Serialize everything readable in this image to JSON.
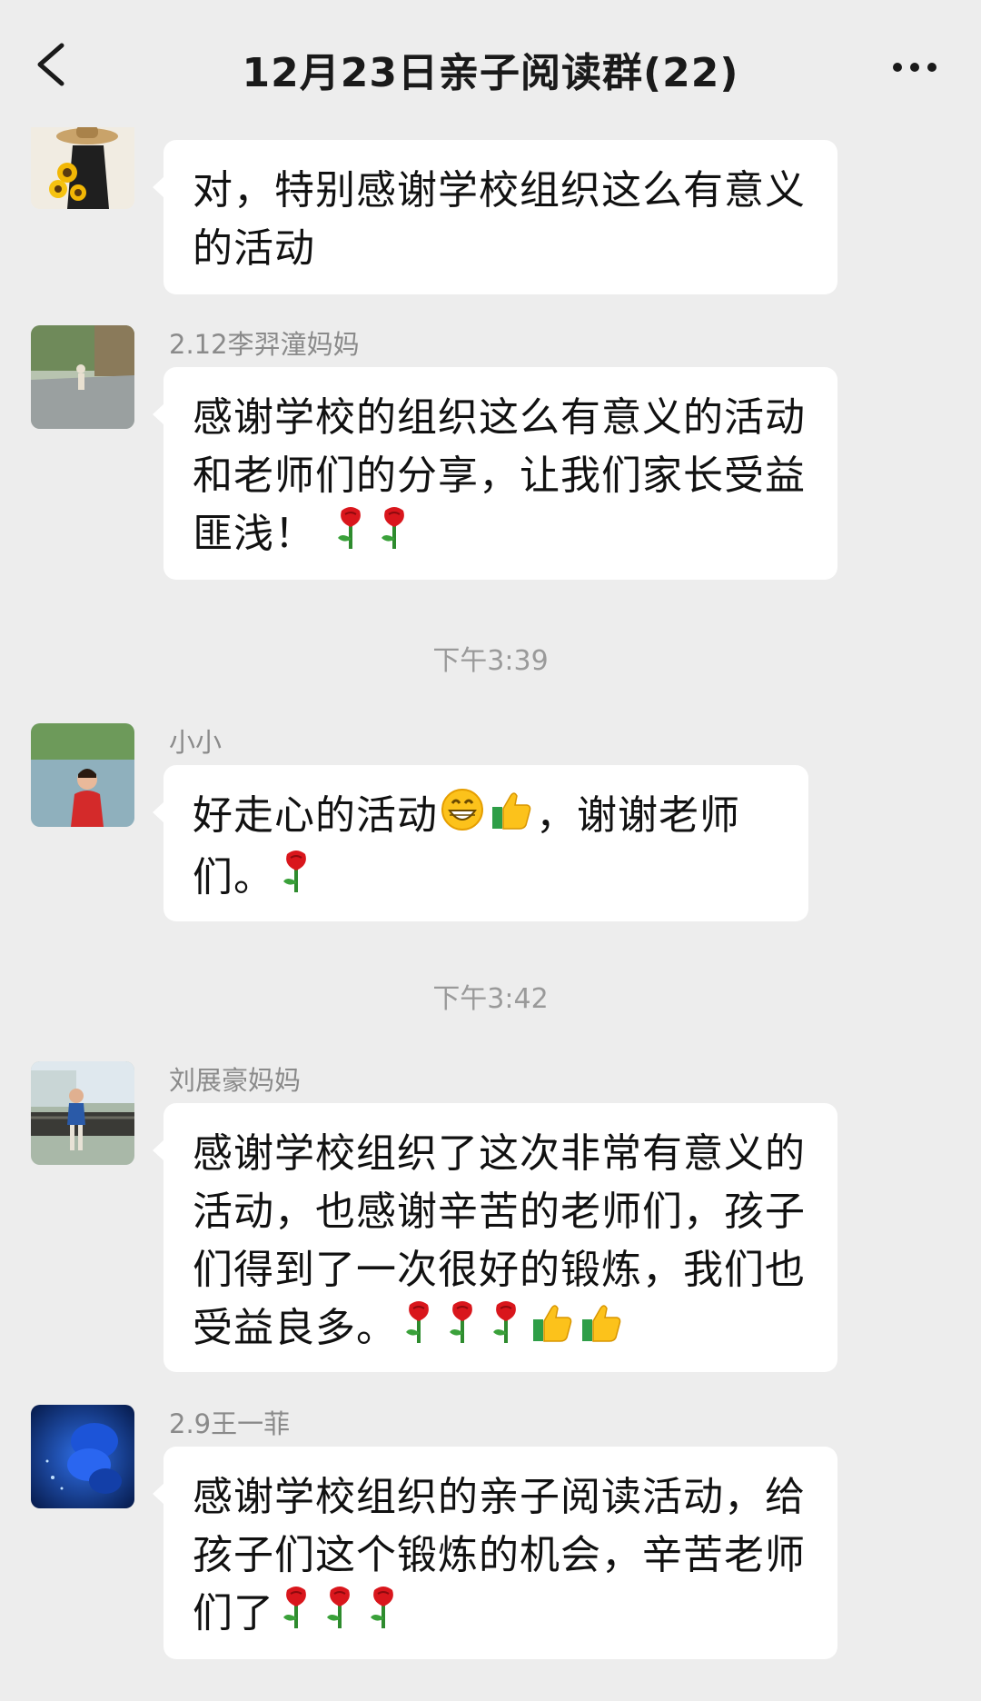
{
  "header": {
    "title": "12月23日亲子阅读群(22)",
    "back_icon": "chevron-left-icon",
    "more_icon": "ellipsis-icon"
  },
  "messages": [
    {
      "sender": "",
      "text": "对，特别感谢学校组织这么有意义的活动",
      "emojis": []
    },
    {
      "sender": "2.12李羿潼妈妈",
      "text": "感谢学校的组织这么有意义的活动和老师们的分享，让我们家长受益匪浅！",
      "emojis": [
        "rose",
        "rose"
      ]
    },
    {
      "time": "下午3:39"
    },
    {
      "sender": "小小",
      "text_before": "好走心的活动",
      "text_after": "，谢谢老师们。",
      "emojis": [
        "grin",
        "thumbs-up",
        "rose"
      ]
    },
    {
      "time": "下午3:42"
    },
    {
      "sender": "刘展豪妈妈",
      "text": "感谢学校组织了这次非常有意义的活动，也感谢辛苦的老师们，孩子们得到了一次很好的锻炼，我们也受益良多。",
      "emojis": [
        "rose",
        "rose",
        "rose",
        "thumbs-up",
        "thumbs-up"
      ]
    },
    {
      "sender": "2.9王一菲",
      "text": "感谢学校组织的亲子阅读活动，给孩子们这个锻炼的机会，辛苦老师们了",
      "emojis": [
        "rose",
        "rose",
        "rose"
      ]
    }
  ],
  "colors": {
    "background": "#ededed",
    "bubble": "#ffffff",
    "sender_text": "#8a8a8a",
    "time_text": "#9a9a9a"
  }
}
